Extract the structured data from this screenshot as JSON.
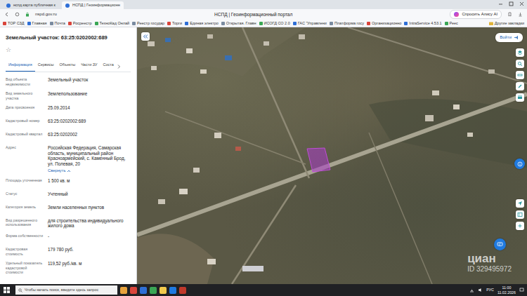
{
  "browser": {
    "tabs": [
      {
        "label": "нспд.карта публичная к",
        "selected": false
      },
      {
        "label": "НСПД | Геоинформационн",
        "selected": true
      }
    ],
    "address": "nspd.gov.ru",
    "title": "НСПД | Геоинформационный портал",
    "alice": "Спросить Алису AI",
    "bookmarks": [
      "TOP СЗД",
      "Главная",
      "Почта",
      "Росреестр",
      "ТехноКад Онлай",
      "Реестр государ",
      "Торги",
      "Единая электро",
      "Открытая. Главн",
      "ИСОГД СО 2.0",
      "ГАС \"Управлени",
      "Платформа госу",
      "Организационно",
      "IntraService 4.53.1",
      "Реес"
    ],
    "other_bookmarks": "Другие закладки"
  },
  "panel": {
    "title": "Земельный участок: 63:25:0202002:689",
    "star": "☆",
    "tabs": [
      {
        "label": "Информация",
        "selected": true
      },
      {
        "label": "Сервисы",
        "selected": false
      },
      {
        "label": "Объекты",
        "selected": false
      },
      {
        "label": "Части ЗУ",
        "selected": false
      },
      {
        "label": "Соста",
        "selected": false
      }
    ],
    "fields": [
      {
        "label": "Вид объекта недвижимости",
        "value": "Земельный участок"
      },
      {
        "label": "Вид земельного участка",
        "value": "Землепользование"
      },
      {
        "label": "Дата присвоения",
        "value": "25.09.2014"
      },
      {
        "label": "Кадастровый номер",
        "value": "63:25:0202002:689"
      },
      {
        "label": "Кадастровый квартал",
        "value": "63:25:0202002"
      },
      {
        "label": "Адрес",
        "value": "Российская Федерация, Самарская область, муниципальный район Красноармейский, с. Каменный Брод, ул. Полевая, 20",
        "toggle": "Свернуть"
      },
      {
        "label": "Площадь уточненная",
        "value": "1 500 кв. м"
      },
      {
        "label": "Статус",
        "value": "Учтенный"
      },
      {
        "label": "Категория земель",
        "value": "Земли населенных пунктов"
      },
      {
        "label": "Вид разрешенного использования",
        "value": "для строительства индивидуального жилого дома"
      },
      {
        "label": "Форма собственности",
        "value": "-"
      },
      {
        "label": "Кадастровая стоимость",
        "value": "179 780 руб."
      },
      {
        "label": "Удельный показатель кадастровой стоимости",
        "value": "119,52 руб./кв. м"
      }
    ]
  },
  "map": {
    "login": "Войти",
    "watermark": {
      "brand": "циан",
      "id": "ID 329495972"
    }
  },
  "taskbar": {
    "search": "Чтобы начать поиск, введите здесь запрос",
    "lang": "РУС",
    "time": "11:00",
    "date": "11.02.2026"
  }
}
